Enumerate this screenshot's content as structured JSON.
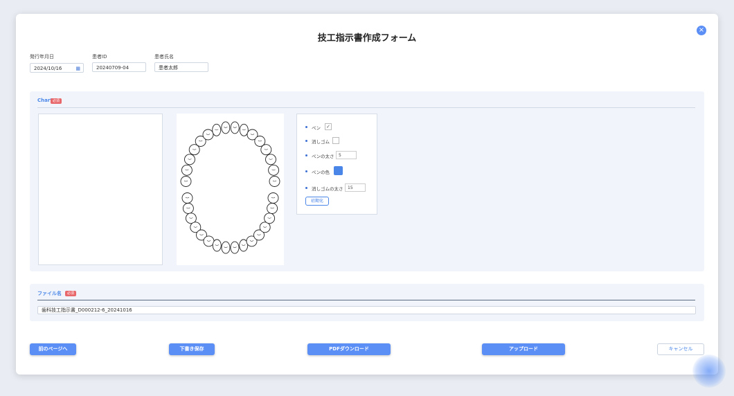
{
  "title": "技工指示書作成フォーム",
  "close_icon": "×",
  "fields": {
    "issue_date_label": "発行年月日",
    "issue_date_value": "2024/10/16",
    "patient_id_label": "患者ID",
    "patient_id_value": "20240709-04",
    "patient_name_label": "患者氏名",
    "patient_name_value": "患者太郎"
  },
  "chart_panel": {
    "title": "Chart",
    "badge": "必須"
  },
  "tools": {
    "pen_label": "ペン",
    "pen_checked": "✓",
    "eraser_label": "消しゴム",
    "pen_width_label": "ペンの太さ",
    "pen_width_value": "5",
    "pen_color_label": "ペンの色",
    "pen_color": "#4a86e8",
    "eraser_width_label": "消しゴムの太さ",
    "eraser_width_value": "15",
    "reset_label": "初期化"
  },
  "file_panel": {
    "title": "ファイル名",
    "badge": "必須",
    "filename_value": "歯科技工指示書_D000212-6_20241016"
  },
  "buttons": {
    "prev": "前のページへ",
    "draft": "下書き保存",
    "pdf": "PDFダウンロード",
    "upload": "アップロード",
    "cancel": "キャンセル"
  },
  "colors": {
    "accent": "#5b8ff5",
    "required_badge": "#e8676a"
  }
}
